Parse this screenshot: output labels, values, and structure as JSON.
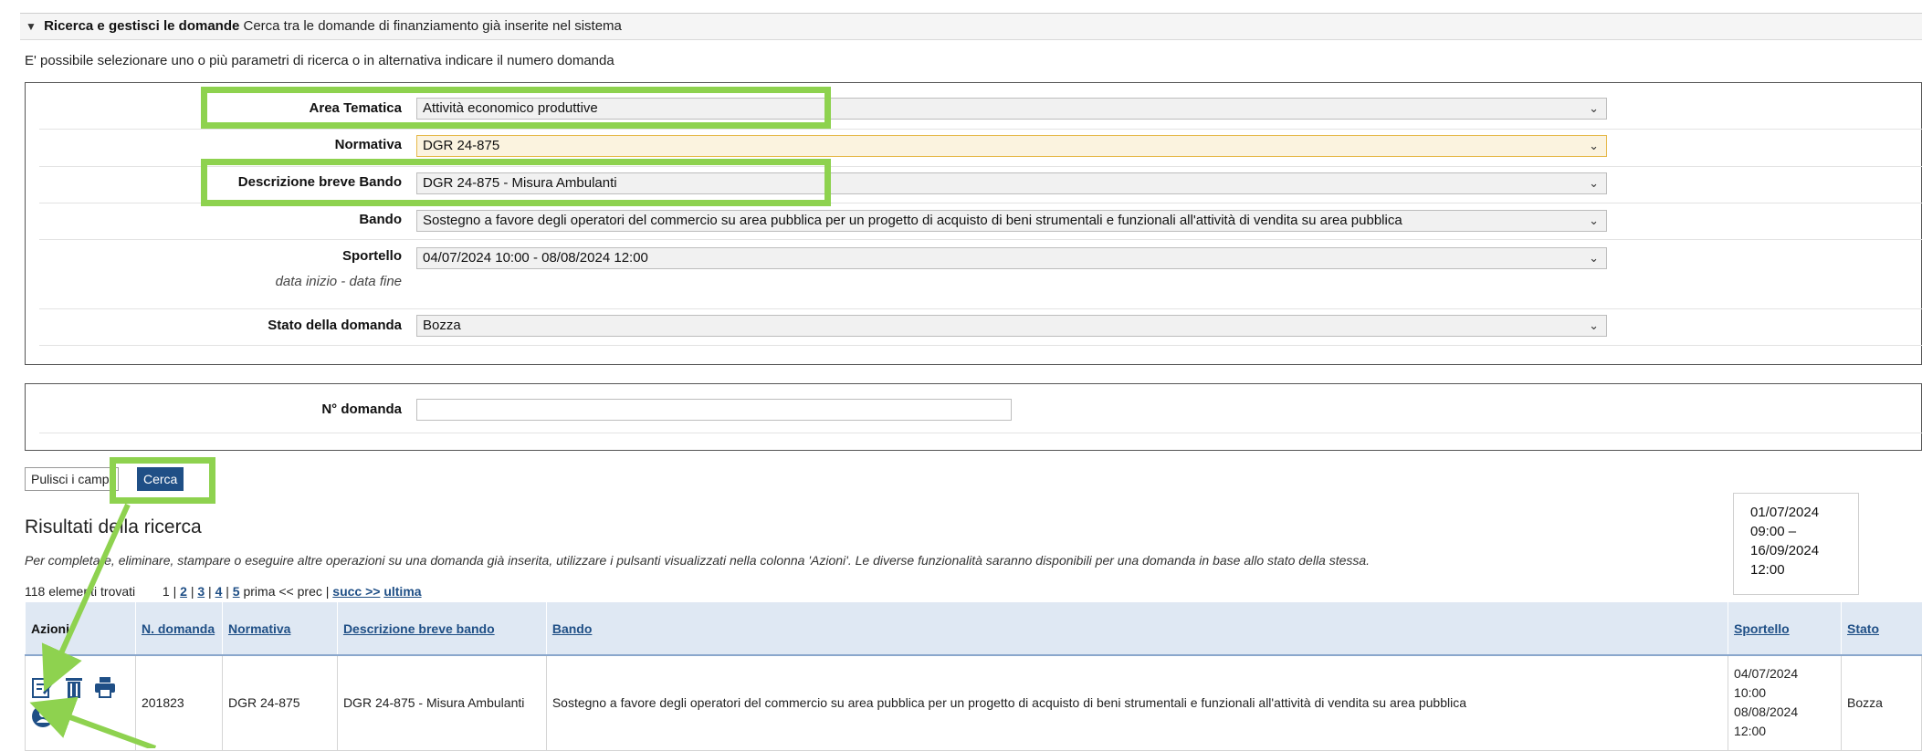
{
  "panel": {
    "title_bold": "Ricerca e gestisci le domande",
    "title_rest": "Cerca tra le domande di finanziamento già inserite nel sistema",
    "intro": "E' possibile selezionare uno o più parametri di ricerca o in alternativa indicare il numero domanda"
  },
  "filters": {
    "area_tematica": {
      "label": "Area Tematica",
      "value": "Attività economico produttive"
    },
    "normativa": {
      "label": "Normativa",
      "value": "DGR 24-875"
    },
    "descrizione": {
      "label": "Descrizione breve Bando",
      "value": "DGR 24-875 - Misura Ambulanti"
    },
    "bando": {
      "label": "Bando",
      "value": "Sostegno a favore degli operatori del commercio su area pubblica per un progetto di acquisto di beni strumentali e funzionali all'attività di vendita su area pubblica"
    },
    "sportello": {
      "label": "Sportello",
      "sublabel": "data inizio - data fine",
      "value": "04/07/2024 10:00 - 08/08/2024 12:00"
    },
    "stato": {
      "label": "Stato della domanda",
      "value": "Bozza"
    }
  },
  "numero_domanda": {
    "label": "N° domanda",
    "value": ""
  },
  "buttons": {
    "clear": "Pulisci i campi",
    "search": "Cerca"
  },
  "results": {
    "title": "Risultati della ricerca",
    "note": "Per completare, eliminare, stampare o eseguire altre operazioni su una domanda già inserita, utilizzare i pulsanti visualizzati nella colonna 'Azioni'. Le diverse funzionalità saranno disponibili per una domanda in base allo stato della stessa.",
    "count": "118 elementi trovati",
    "pager": {
      "current": "1",
      "pages": [
        "2",
        "3",
        "4",
        "5"
      ],
      "mid": "prima << prec |",
      "next": "succ >>",
      "last": "ultima"
    },
    "columns": {
      "azioni": "Azioni",
      "n_domanda": "N. domanda",
      "normativa": "Normativa",
      "descrizione": "Descrizione breve bando",
      "bando": "Bando",
      "sportello": "Sportello",
      "stato": "Stato"
    },
    "row": {
      "n_domanda": "201823",
      "normativa": "DGR 24-875",
      "descrizione": "DGR 24-875 - Misura Ambulanti",
      "bando": "Sostegno a favore degli operatori del commercio su area pubblica per un progetto di acquisto di beni strumentali e funzionali all'attività di vendita su area pubblica",
      "sportello": [
        "04/07/2024",
        "10:00",
        "08/08/2024",
        "12:00"
      ],
      "stato": "Bozza"
    }
  },
  "date_box": [
    "01/07/2024",
    "09:00 –",
    "16/09/2024",
    "12:00"
  ],
  "colors": {
    "highlight": "#8ed24f",
    "primary": "#1f4f86",
    "header_bg": "#dfe8f3"
  }
}
